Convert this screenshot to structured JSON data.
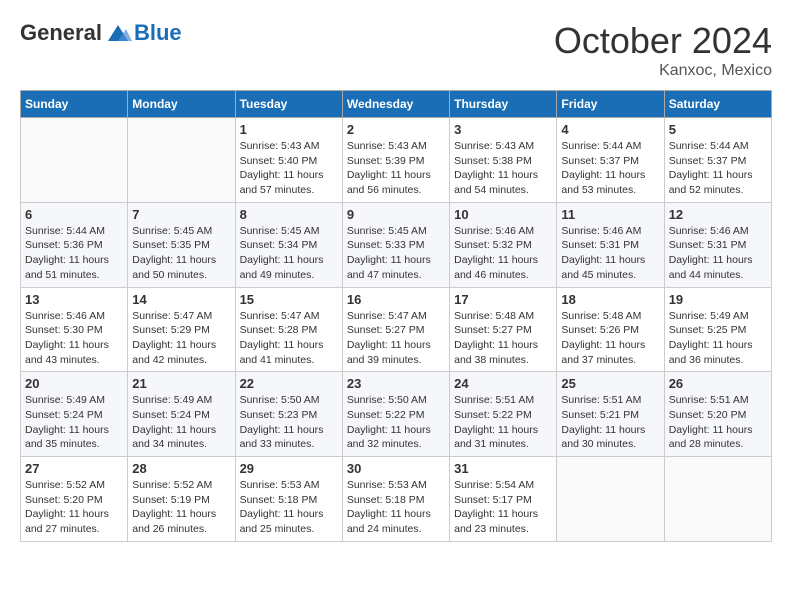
{
  "header": {
    "logo": {
      "general": "General",
      "blue": "Blue"
    },
    "month": "October 2024",
    "location": "Kanxoc, Mexico"
  },
  "weekdays": [
    "Sunday",
    "Monday",
    "Tuesday",
    "Wednesday",
    "Thursday",
    "Friday",
    "Saturday"
  ],
  "weeks": [
    [
      {
        "day": "",
        "info": ""
      },
      {
        "day": "",
        "info": ""
      },
      {
        "day": "1",
        "info": "Sunrise: 5:43 AM\nSunset: 5:40 PM\nDaylight: 11 hours and 57 minutes."
      },
      {
        "day": "2",
        "info": "Sunrise: 5:43 AM\nSunset: 5:39 PM\nDaylight: 11 hours and 56 minutes."
      },
      {
        "day": "3",
        "info": "Sunrise: 5:43 AM\nSunset: 5:38 PM\nDaylight: 11 hours and 54 minutes."
      },
      {
        "day": "4",
        "info": "Sunrise: 5:44 AM\nSunset: 5:37 PM\nDaylight: 11 hours and 53 minutes."
      },
      {
        "day": "5",
        "info": "Sunrise: 5:44 AM\nSunset: 5:37 PM\nDaylight: 11 hours and 52 minutes."
      }
    ],
    [
      {
        "day": "6",
        "info": "Sunrise: 5:44 AM\nSunset: 5:36 PM\nDaylight: 11 hours and 51 minutes."
      },
      {
        "day": "7",
        "info": "Sunrise: 5:45 AM\nSunset: 5:35 PM\nDaylight: 11 hours and 50 minutes."
      },
      {
        "day": "8",
        "info": "Sunrise: 5:45 AM\nSunset: 5:34 PM\nDaylight: 11 hours and 49 minutes."
      },
      {
        "day": "9",
        "info": "Sunrise: 5:45 AM\nSunset: 5:33 PM\nDaylight: 11 hours and 47 minutes."
      },
      {
        "day": "10",
        "info": "Sunrise: 5:46 AM\nSunset: 5:32 PM\nDaylight: 11 hours and 46 minutes."
      },
      {
        "day": "11",
        "info": "Sunrise: 5:46 AM\nSunset: 5:31 PM\nDaylight: 11 hours and 45 minutes."
      },
      {
        "day": "12",
        "info": "Sunrise: 5:46 AM\nSunset: 5:31 PM\nDaylight: 11 hours and 44 minutes."
      }
    ],
    [
      {
        "day": "13",
        "info": "Sunrise: 5:46 AM\nSunset: 5:30 PM\nDaylight: 11 hours and 43 minutes."
      },
      {
        "day": "14",
        "info": "Sunrise: 5:47 AM\nSunset: 5:29 PM\nDaylight: 11 hours and 42 minutes."
      },
      {
        "day": "15",
        "info": "Sunrise: 5:47 AM\nSunset: 5:28 PM\nDaylight: 11 hours and 41 minutes."
      },
      {
        "day": "16",
        "info": "Sunrise: 5:47 AM\nSunset: 5:27 PM\nDaylight: 11 hours and 39 minutes."
      },
      {
        "day": "17",
        "info": "Sunrise: 5:48 AM\nSunset: 5:27 PM\nDaylight: 11 hours and 38 minutes."
      },
      {
        "day": "18",
        "info": "Sunrise: 5:48 AM\nSunset: 5:26 PM\nDaylight: 11 hours and 37 minutes."
      },
      {
        "day": "19",
        "info": "Sunrise: 5:49 AM\nSunset: 5:25 PM\nDaylight: 11 hours and 36 minutes."
      }
    ],
    [
      {
        "day": "20",
        "info": "Sunrise: 5:49 AM\nSunset: 5:24 PM\nDaylight: 11 hours and 35 minutes."
      },
      {
        "day": "21",
        "info": "Sunrise: 5:49 AM\nSunset: 5:24 PM\nDaylight: 11 hours and 34 minutes."
      },
      {
        "day": "22",
        "info": "Sunrise: 5:50 AM\nSunset: 5:23 PM\nDaylight: 11 hours and 33 minutes."
      },
      {
        "day": "23",
        "info": "Sunrise: 5:50 AM\nSunset: 5:22 PM\nDaylight: 11 hours and 32 minutes."
      },
      {
        "day": "24",
        "info": "Sunrise: 5:51 AM\nSunset: 5:22 PM\nDaylight: 11 hours and 31 minutes."
      },
      {
        "day": "25",
        "info": "Sunrise: 5:51 AM\nSunset: 5:21 PM\nDaylight: 11 hours and 30 minutes."
      },
      {
        "day": "26",
        "info": "Sunrise: 5:51 AM\nSunset: 5:20 PM\nDaylight: 11 hours and 28 minutes."
      }
    ],
    [
      {
        "day": "27",
        "info": "Sunrise: 5:52 AM\nSunset: 5:20 PM\nDaylight: 11 hours and 27 minutes."
      },
      {
        "day": "28",
        "info": "Sunrise: 5:52 AM\nSunset: 5:19 PM\nDaylight: 11 hours and 26 minutes."
      },
      {
        "day": "29",
        "info": "Sunrise: 5:53 AM\nSunset: 5:18 PM\nDaylight: 11 hours and 25 minutes."
      },
      {
        "day": "30",
        "info": "Sunrise: 5:53 AM\nSunset: 5:18 PM\nDaylight: 11 hours and 24 minutes."
      },
      {
        "day": "31",
        "info": "Sunrise: 5:54 AM\nSunset: 5:17 PM\nDaylight: 11 hours and 23 minutes."
      },
      {
        "day": "",
        "info": ""
      },
      {
        "day": "",
        "info": ""
      }
    ]
  ]
}
